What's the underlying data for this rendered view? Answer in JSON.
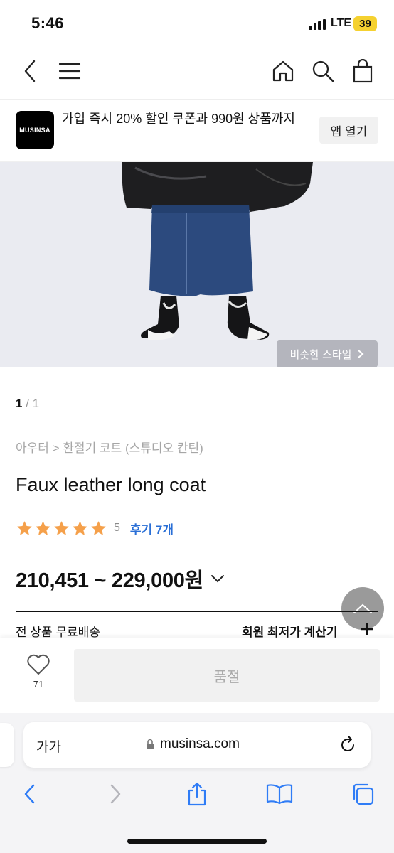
{
  "status_bar": {
    "time": "5:46",
    "network": "LTE",
    "battery": "39"
  },
  "nav": {
    "icons": [
      "back-icon",
      "menu-icon",
      "home-icon",
      "search-icon",
      "bag-icon"
    ]
  },
  "app_banner": {
    "logo_text": "MUSINSA",
    "message": "가입 즉시 20% 할인 쿠폰과 990원 상품까지",
    "open_button": "앱 열기"
  },
  "product_image": {
    "similar_style_button": "비슷한 스타일"
  },
  "pager": {
    "current": "1",
    "separator": "/ 1"
  },
  "breadcrumb": "아우터 > 환절기 코트 (스튜디오 칸틴)",
  "product": {
    "title": "Faux leather long coat",
    "rating": 5,
    "rating_text": "5",
    "reviews_label": "후기 7개",
    "price": "210,451 ~ 229,000원"
  },
  "shipping_text": "전 상품 무료배송",
  "member_price_text": "회원 최저가 계산기",
  "purchase_bar": {
    "like_count": "71",
    "soldout_label": "품절"
  },
  "safari": {
    "text_size_label": "가가",
    "url": "musinsa.com"
  },
  "colors": {
    "star": "#f5a04a",
    "link": "#2a6fd6",
    "safari_blue": "#2f7cf6"
  }
}
